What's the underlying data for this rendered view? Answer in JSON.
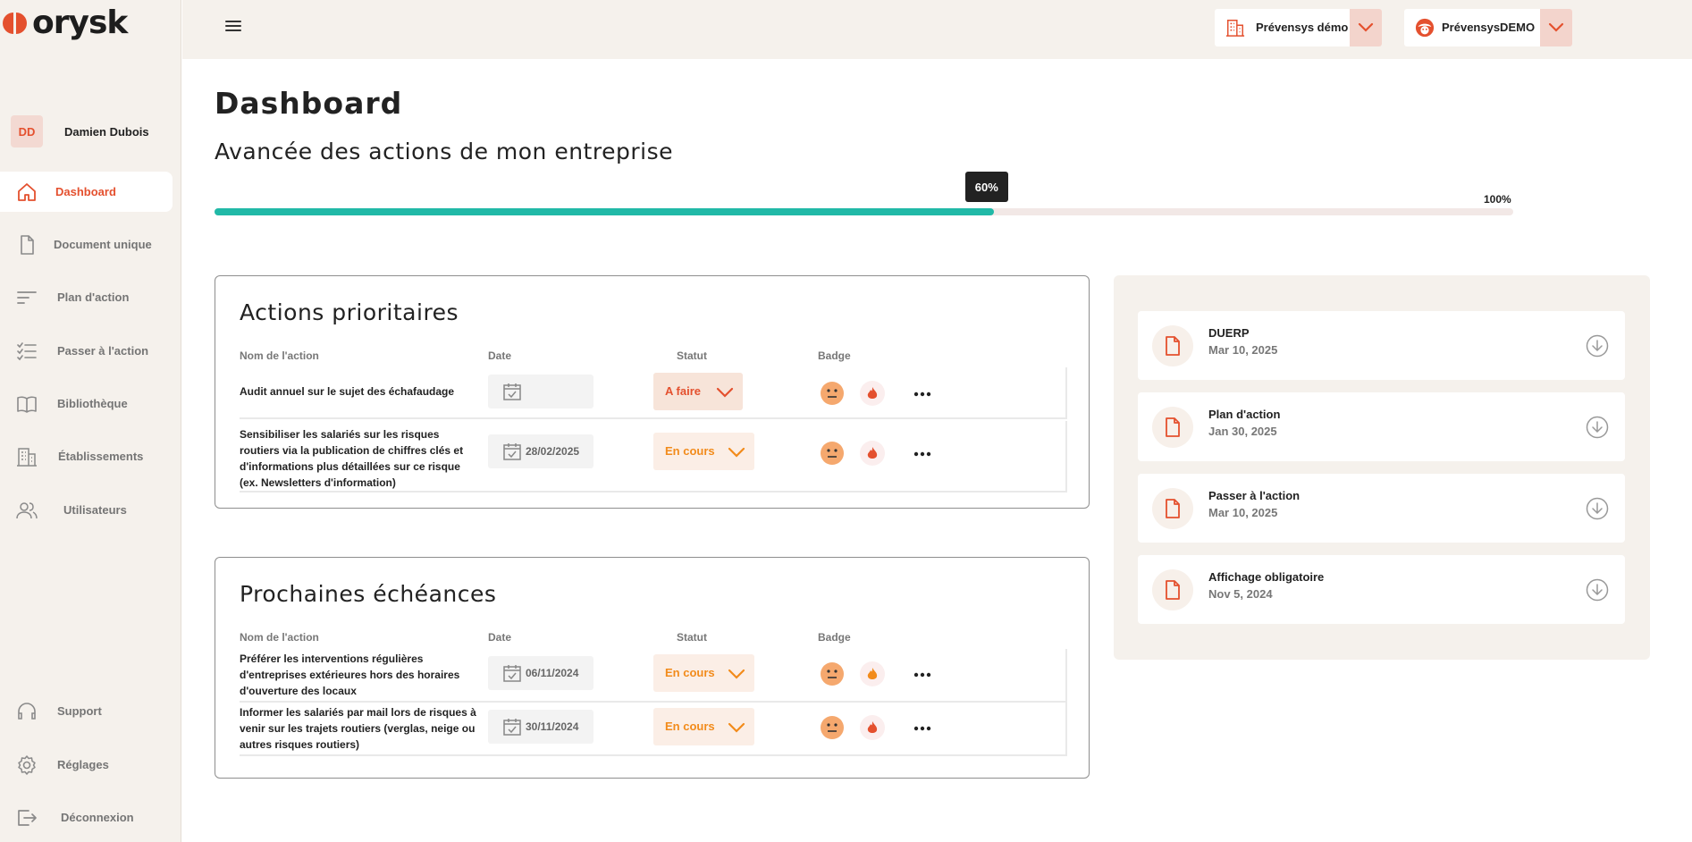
{
  "brand": {
    "name": "orysk",
    "accent": "#e4502e",
    "teal": "#21b9a7",
    "cream": "#f5f1ec"
  },
  "user": {
    "initials": "DD",
    "name": "Damien Dubois"
  },
  "nav": {
    "dashboard": "Dashboard",
    "document_unique": "Document unique",
    "plan_action": "Plan d'action",
    "passer_action": "Passer à l'action",
    "bibliotheque": "Bibliothèque",
    "etablissements": "Établissements",
    "utilisateurs": "Utilisateurs",
    "support": "Support",
    "reglages": "Réglages",
    "deconnexion": "Déconnexion"
  },
  "topbar": {
    "company_selector": {
      "label": "Prévensys démo",
      "icon": "building-icon"
    },
    "account_selector": {
      "label": "PrévensysDEMO",
      "icon": "user-face-icon"
    }
  },
  "page": {
    "title": "Dashboard",
    "progress_title": "Avancée des actions de mon entreprise",
    "progress": {
      "value": 0.6,
      "label": "60%",
      "max_label": "100%"
    }
  },
  "priority_actions": {
    "title": "Actions prioritaires",
    "columns": {
      "name": "Nom de l'action",
      "date": "Date",
      "status": "Statut",
      "badge": "Badge"
    },
    "rows": [
      {
        "name": "Audit annuel sur le sujet des échafaudage",
        "date": "",
        "status": "A faire",
        "flame_color": "#e4502e"
      },
      {
        "name": "Sensibiliser les salariés sur les risques routiers via la publication de chiffres clés et d'informations plus détaillées sur ce risque (ex. Newsletters d'information)",
        "date": "28/02/2025",
        "status": "En cours",
        "flame_color": "#e4502e"
      }
    ]
  },
  "deadlines": {
    "title": "Prochaines échéances",
    "columns": {
      "name": "Nom de l'action",
      "date": "Date",
      "status": "Statut",
      "badge": "Badge"
    },
    "rows": [
      {
        "name": "Préférer les interventions régulières d'entreprises extérieures hors des horaires d'ouverture des locaux",
        "date": "06/11/2024",
        "status": "En cours",
        "flame_color": "#f28b1b"
      },
      {
        "name": "Informer les salariés par mail lors de risques à venir sur les trajets routiers (verglas, neige ou autres risques routiers)",
        "date": "30/11/2024",
        "status": "En cours",
        "flame_color": "#e4502e"
      }
    ]
  },
  "documents": [
    {
      "name": "DUERP",
      "date": "Mar 10, 2025"
    },
    {
      "name": "Plan d'action",
      "date": "Jan 30, 2025"
    },
    {
      "name": "Passer à l'action",
      "date": "Mar 10, 2025"
    },
    {
      "name": "Affichage obligatoire",
      "date": "Nov 5, 2024"
    }
  ]
}
